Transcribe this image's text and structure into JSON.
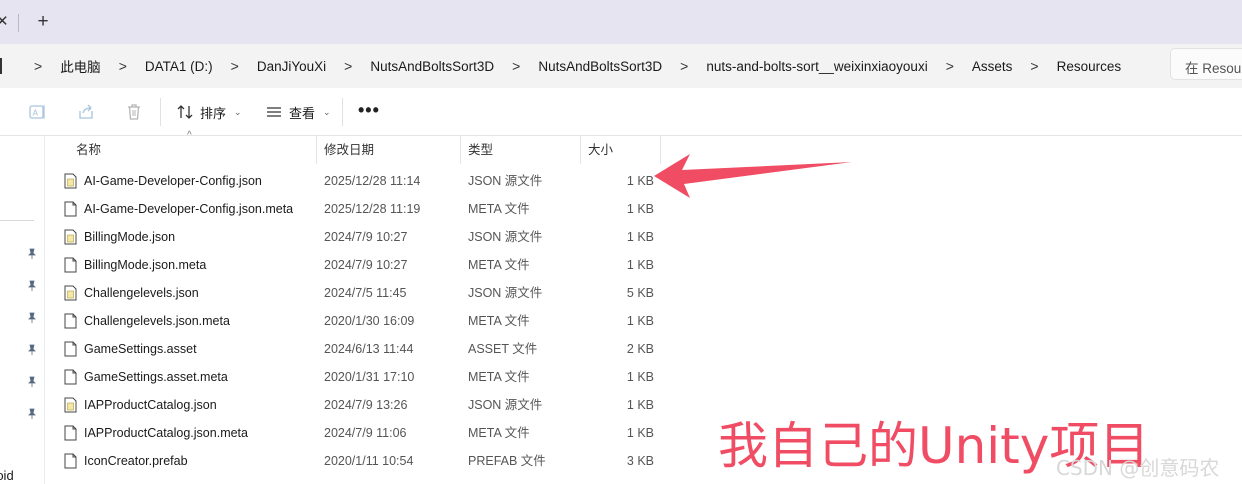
{
  "tab": {
    "close_glyph": "✕",
    "add_glyph": "+"
  },
  "breadcrumb": {
    "items": [
      "此电脑",
      "DATA1 (D:)",
      "DanJiYouXi",
      "NutsAndBoltsSort3D",
      "NutsAndBoltsSort3D",
      "nuts-and-bolts-sort__weixinxiaoyouxi",
      "Assets",
      "Resources"
    ],
    "separator": ">"
  },
  "search": {
    "placeholder": "在 Resources 中搜索"
  },
  "toolbar": {
    "sort_label": "排序",
    "view_label": "查看",
    "more_label": "•••"
  },
  "sidebar": {
    "partial_label": "roid"
  },
  "columns": {
    "name": "名称",
    "date": "修改日期",
    "type": "类型",
    "size": "大小"
  },
  "files": [
    {
      "name": "AI-Game-Developer-Config.json",
      "date": "2025/12/28 11:14",
      "type": "JSON 源文件",
      "size": "1 KB",
      "icon": "json-file-icon"
    },
    {
      "name": "AI-Game-Developer-Config.json.meta",
      "date": "2025/12/28 11:19",
      "type": "META 文件",
      "size": "1 KB",
      "icon": "file-icon"
    },
    {
      "name": "BillingMode.json",
      "date": "2024/7/9 10:27",
      "type": "JSON 源文件",
      "size": "1 KB",
      "icon": "json-file-icon"
    },
    {
      "name": "BillingMode.json.meta",
      "date": "2024/7/9 10:27",
      "type": "META 文件",
      "size": "1 KB",
      "icon": "file-icon"
    },
    {
      "name": "Challengelevels.json",
      "date": "2024/7/5 11:45",
      "type": "JSON 源文件",
      "size": "5 KB",
      "icon": "json-file-icon"
    },
    {
      "name": "Challengelevels.json.meta",
      "date": "2020/1/30 16:09",
      "type": "META 文件",
      "size": "1 KB",
      "icon": "file-icon"
    },
    {
      "name": "GameSettings.asset",
      "date": "2024/6/13 11:44",
      "type": "ASSET 文件",
      "size": "2 KB",
      "icon": "file-icon"
    },
    {
      "name": "GameSettings.asset.meta",
      "date": "2020/1/31 17:10",
      "type": "META 文件",
      "size": "1 KB",
      "icon": "file-icon"
    },
    {
      "name": "IAPProductCatalog.json",
      "date": "2024/7/9 13:26",
      "type": "JSON 源文件",
      "size": "1 KB",
      "icon": "json-file-icon"
    },
    {
      "name": "IAPProductCatalog.json.meta",
      "date": "2024/7/9 11:06",
      "type": "META 文件",
      "size": "1 KB",
      "icon": "file-icon"
    },
    {
      "name": "IconCreator.prefab",
      "date": "2020/1/11 10:54",
      "type": "PREFAB 文件",
      "size": "3 KB",
      "icon": "file-icon"
    }
  ],
  "annotation": {
    "text": "我自己的Unity项目",
    "color": "#f04c63"
  },
  "watermark": {
    "text": "CSDN @创意码农"
  }
}
